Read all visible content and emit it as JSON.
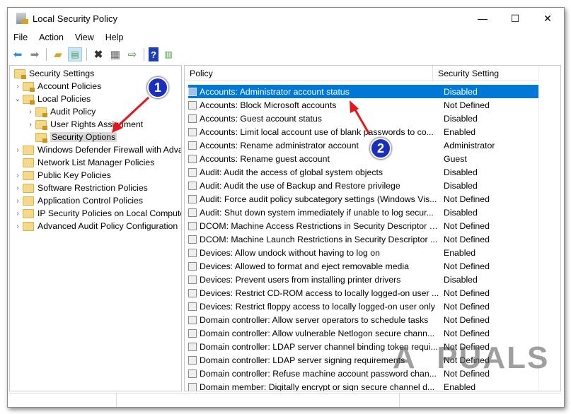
{
  "window": {
    "title": "Local Security Policy",
    "minimize": "—",
    "maximize": "☐",
    "close": "✕"
  },
  "menu": [
    "File",
    "Action",
    "View",
    "Help"
  ],
  "toolbar": [
    "back-icon",
    "forward-icon",
    "up-folder-icon",
    "show-hide-tree-icon",
    "delete-icon",
    "properties-icon",
    "export-list-icon",
    "help-icon",
    "show-action-pane-icon"
  ],
  "tree": [
    {
      "label": "Security Settings",
      "level": 0,
      "chev": ""
    },
    {
      "label": "Account Policies",
      "level": 1,
      "chev": ">"
    },
    {
      "label": "Local Policies",
      "level": 1,
      "chev": "v"
    },
    {
      "label": "Audit Policy",
      "level": 2,
      "chev": ">"
    },
    {
      "label": "User Rights Assignment",
      "level": 2,
      "chev": ">"
    },
    {
      "label": "Security Options",
      "level": 2,
      "chev": "",
      "selected": true
    },
    {
      "label": "Windows Defender Firewall with Adva",
      "level": 1,
      "chev": ">"
    },
    {
      "label": "Network List Manager Policies",
      "level": 1,
      "chev": ""
    },
    {
      "label": "Public Key Policies",
      "level": 1,
      "chev": ">"
    },
    {
      "label": "Software Restriction Policies",
      "level": 1,
      "chev": ">"
    },
    {
      "label": "Application Control Policies",
      "level": 1,
      "chev": ">"
    },
    {
      "label": "IP Security Policies on Local Compute",
      "level": 1,
      "chev": ">"
    },
    {
      "label": "Advanced Audit Policy Configuration",
      "level": 1,
      "chev": ">"
    }
  ],
  "table": {
    "columns": [
      "Policy",
      "Security Setting"
    ],
    "rows": [
      [
        "Accounts: Administrator account status",
        "Disabled"
      ],
      [
        "Accounts: Block Microsoft accounts",
        "Not Defined"
      ],
      [
        "Accounts: Guest account status",
        "Disabled"
      ],
      [
        "Accounts: Limit local account use of blank passwords to co...",
        "Enabled"
      ],
      [
        "Accounts: Rename administrator account",
        "Administrator"
      ],
      [
        "Accounts: Rename guest account",
        "Guest"
      ],
      [
        "Audit: Audit the access of global system objects",
        "Disabled"
      ],
      [
        "Audit: Audit the use of Backup and Restore privilege",
        "Disabled"
      ],
      [
        "Audit: Force audit policy subcategory settings (Windows Vis...",
        "Not Defined"
      ],
      [
        "Audit: Shut down system immediately if unable to log secur...",
        "Disabled"
      ],
      [
        "DCOM: Machine Access Restrictions in Security Descriptor D...",
        "Not Defined"
      ],
      [
        "DCOM: Machine Launch Restrictions in Security Descriptor ...",
        "Not Defined"
      ],
      [
        "Devices: Allow undock without having to log on",
        "Enabled"
      ],
      [
        "Devices: Allowed to format and eject removable media",
        "Not Defined"
      ],
      [
        "Devices: Prevent users from installing printer drivers",
        "Disabled"
      ],
      [
        "Devices: Restrict CD-ROM access to locally logged-on user ...",
        "Not Defined"
      ],
      [
        "Devices: Restrict floppy access to locally logged-on user only",
        "Not Defined"
      ],
      [
        "Domain controller: Allow server operators to schedule tasks",
        "Not Defined"
      ],
      [
        "Domain controller: Allow vulnerable Netlogon secure chann...",
        "Not Defined"
      ],
      [
        "Domain controller: LDAP server channel binding token requi...",
        "Not Defined"
      ],
      [
        "Domain controller: LDAP server signing requirements",
        "Not Defined"
      ],
      [
        "Domain controller: Refuse machine account password chan...",
        "Not Defined"
      ],
      [
        "Domain member: Digitally encrypt or sign secure channel d...",
        "Enabled"
      ]
    ]
  },
  "annotations": [
    "1",
    "2"
  ],
  "watermark": "APPUALS",
  "colors": {
    "selection": "#0078d7",
    "badge": "#1a2fc0",
    "arrow": "#e8151b"
  }
}
